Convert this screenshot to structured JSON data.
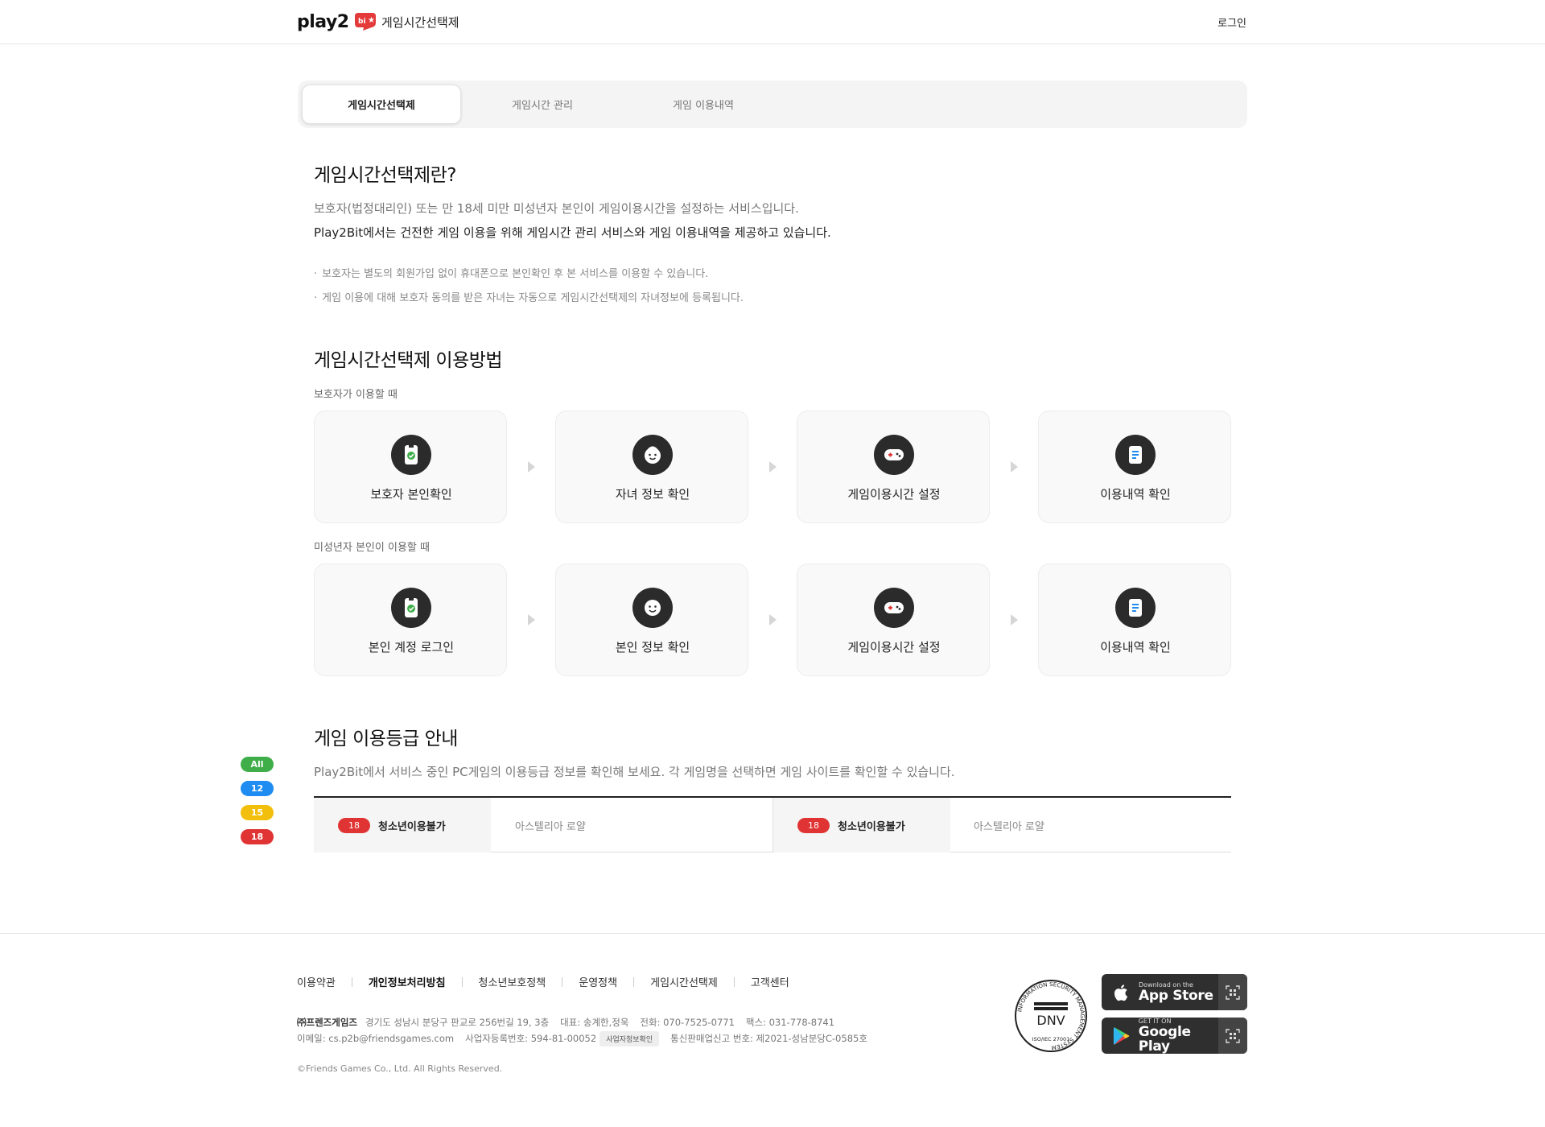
{
  "header": {
    "logo_text": "play2",
    "logo_badge": "bit",
    "service_name": "게임시간선택제",
    "login": "로그인"
  },
  "tabs": [
    {
      "label": "게임시간선택제",
      "active": true
    },
    {
      "label": "게임시간 관리",
      "active": false
    },
    {
      "label": "게임 이용내역",
      "active": false
    }
  ],
  "intro": {
    "title": "게임시간선택제란?",
    "desc1": "보호자(법정대리인) 또는 만 18세 미만 미성년자 본인이 게임이용시간을 설정하는 서비스입니다.",
    "desc2": "Play2Bit에서는 건전한 게임 이용을 위해 게임시간 관리 서비스와 게임 이용내역을 제공하고 있습니다.",
    "bullets": [
      "보호자는 별도의 회원가입 없이 휴대폰으로 본인확인 후 본 서비스를 이용할 수 있습니다.",
      "게임 이용에 대해 보호자 동의를 받은 자녀는 자동으로 게임시간선택제의 자녀정보에 등록됩니다."
    ]
  },
  "usage": {
    "title": "게임시간선택제 이용방법",
    "guardian": {
      "label": "보호자가 이용할 때",
      "steps": [
        {
          "label": "보호자 본인확인",
          "icon": "phone-check-icon"
        },
        {
          "label": "자녀 정보 확인",
          "icon": "child-face-icon"
        },
        {
          "label": "게임이용시간 설정",
          "icon": "gamepad-icon"
        },
        {
          "label": "이용내역 확인",
          "icon": "document-icon"
        }
      ]
    },
    "minor": {
      "label": "미성년자 본인이 이용할 때",
      "steps": [
        {
          "label": "본인 계정 로그인",
          "icon": "phone-check-icon"
        },
        {
          "label": "본인 정보 확인",
          "icon": "smile-face-icon"
        },
        {
          "label": "게임이용시간 설정",
          "icon": "gamepad-icon"
        },
        {
          "label": "이용내역 확인",
          "icon": "document-icon"
        }
      ]
    }
  },
  "grade": {
    "title": "게임 이용등급 안내",
    "desc": "Play2Bit에서 서비스 중인 PC게임의 이용등급 정보를 확인해 보세요. 각 게임명을 선택하면 게임 사이트를 확인할 수 있습니다.",
    "side_badges": [
      {
        "label": "All",
        "color": "#3fae49"
      },
      {
        "label": "12",
        "color": "#1e8cf0"
      },
      {
        "label": "15",
        "color": "#f2bf0c"
      },
      {
        "label": "18",
        "color": "#e03333"
      }
    ],
    "rows": [
      {
        "badge": "18",
        "rating": "청소년이용불가",
        "game": "아스텔리아 로얄"
      },
      {
        "badge": "18",
        "rating": "청소년이용불가",
        "game": "아스텔리아 로얄"
      }
    ]
  },
  "footer": {
    "links": [
      {
        "label": "이용약관",
        "bold": false
      },
      {
        "label": "개인정보처리방침",
        "bold": true
      },
      {
        "label": "청소년보호정책",
        "bold": false
      },
      {
        "label": "운영정책",
        "bold": false
      },
      {
        "label": "게임시간선택제",
        "bold": false
      },
      {
        "label": "고객센터",
        "bold": false
      }
    ],
    "company": "㈜프렌즈게임즈",
    "address": "경기도 성남시 분당구 판교로 256번길 19, 3층",
    "ceo": "대표: 송계한,정욱",
    "phone": "전화: 070-7525-0771",
    "fax": "팩스: 031-778-8741",
    "email": "이메일: cs.p2b@friendsgames.com",
    "biz_no": "사업자등록번호: 594-81-00052",
    "biz_btn": "사업자정보확인",
    "mail_order": "통신판매업신고 번호: 제2021-성남분당C-0585호",
    "copyright": "©Friends Games Co., Ltd. All Rights Reserved.",
    "dnv_text": "DNV",
    "dnv_ring": "INFORMATION SECURITY MANAGEMENT SYSTEM",
    "dnv_iso": "ISO/IEC 27001",
    "appstore_small": "Download on the",
    "appstore_big": "App Store",
    "googleplay_small": "GET IT ON",
    "googleplay_big": "Google Play"
  }
}
